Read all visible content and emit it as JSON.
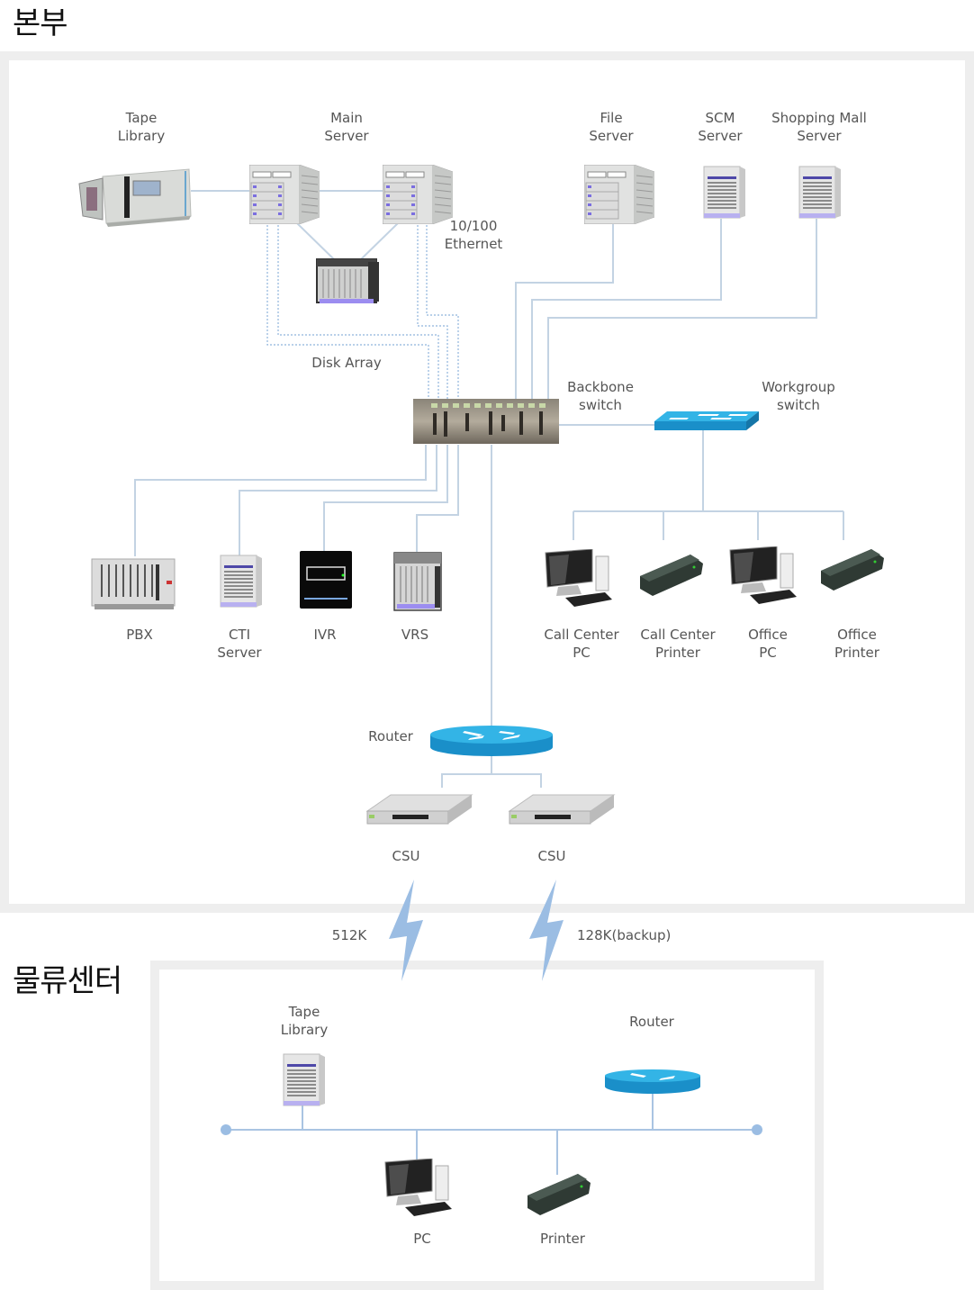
{
  "sections": {
    "hq": {
      "title": "본부",
      "devices": {
        "tape_library": "Tape\nLibrary",
        "main_server": "Main\nServer",
        "ethernet": "10/100\nEthernet",
        "disk_array": "Disk Array",
        "file_server": "File\nServer",
        "scm_server": "SCM\nServer",
        "mall_server": "Shopping Mall\nServer",
        "backbone_switch": "Backbone\nswitch",
        "workgroup_switch": "Workgroup\nswitch",
        "pbx": "PBX",
        "cti_server": "CTI\nServer",
        "ivr": "IVR",
        "vrs": "VRS",
        "cc_pc": "Call Center\nPC",
        "cc_printer": "Call Center\nPrinter",
        "office_pc": "Office\nPC",
        "office_printer": "Office\nPrinter",
        "router": "Router",
        "csu1": "CSU",
        "csu2": "CSU"
      }
    },
    "links": {
      "primary": "512K",
      "backup": "128K(backup)"
    },
    "branch": {
      "title": "물류센터",
      "devices": {
        "tape_library": "Tape\nLibrary",
        "router": "Router",
        "pc": "PC",
        "printer": "Printer"
      }
    }
  },
  "colors": {
    "wire": "#c3d3e3",
    "dotted_wire": "#8fb4dc",
    "frame": "#eeeeee",
    "router_blue": "#1a8fc9",
    "bolt": "#9bbde3",
    "bus_dot": "#9bbde3"
  }
}
